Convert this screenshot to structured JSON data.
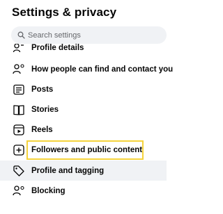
{
  "header": {
    "title": "Settings & privacy"
  },
  "search": {
    "placeholder": "Search settings"
  },
  "menu": {
    "items": [
      {
        "label": "Profile details",
        "icon": "user-card-icon"
      },
      {
        "label": "How people can find and contact you",
        "icon": "people-search-icon"
      },
      {
        "label": "Posts",
        "icon": "posts-icon"
      },
      {
        "label": "Stories",
        "icon": "stories-icon"
      },
      {
        "label": "Reels",
        "icon": "reels-icon"
      },
      {
        "label": "Followers and public content",
        "icon": "add-follower-icon"
      },
      {
        "label": "Profile and tagging",
        "icon": "tag-icon"
      },
      {
        "label": "Blocking",
        "icon": "block-user-icon"
      }
    ]
  },
  "colors": {
    "highlight_border": "#f5d33c",
    "hover_row": "#f0f2f5",
    "search_bg": "#f0f2f5"
  }
}
